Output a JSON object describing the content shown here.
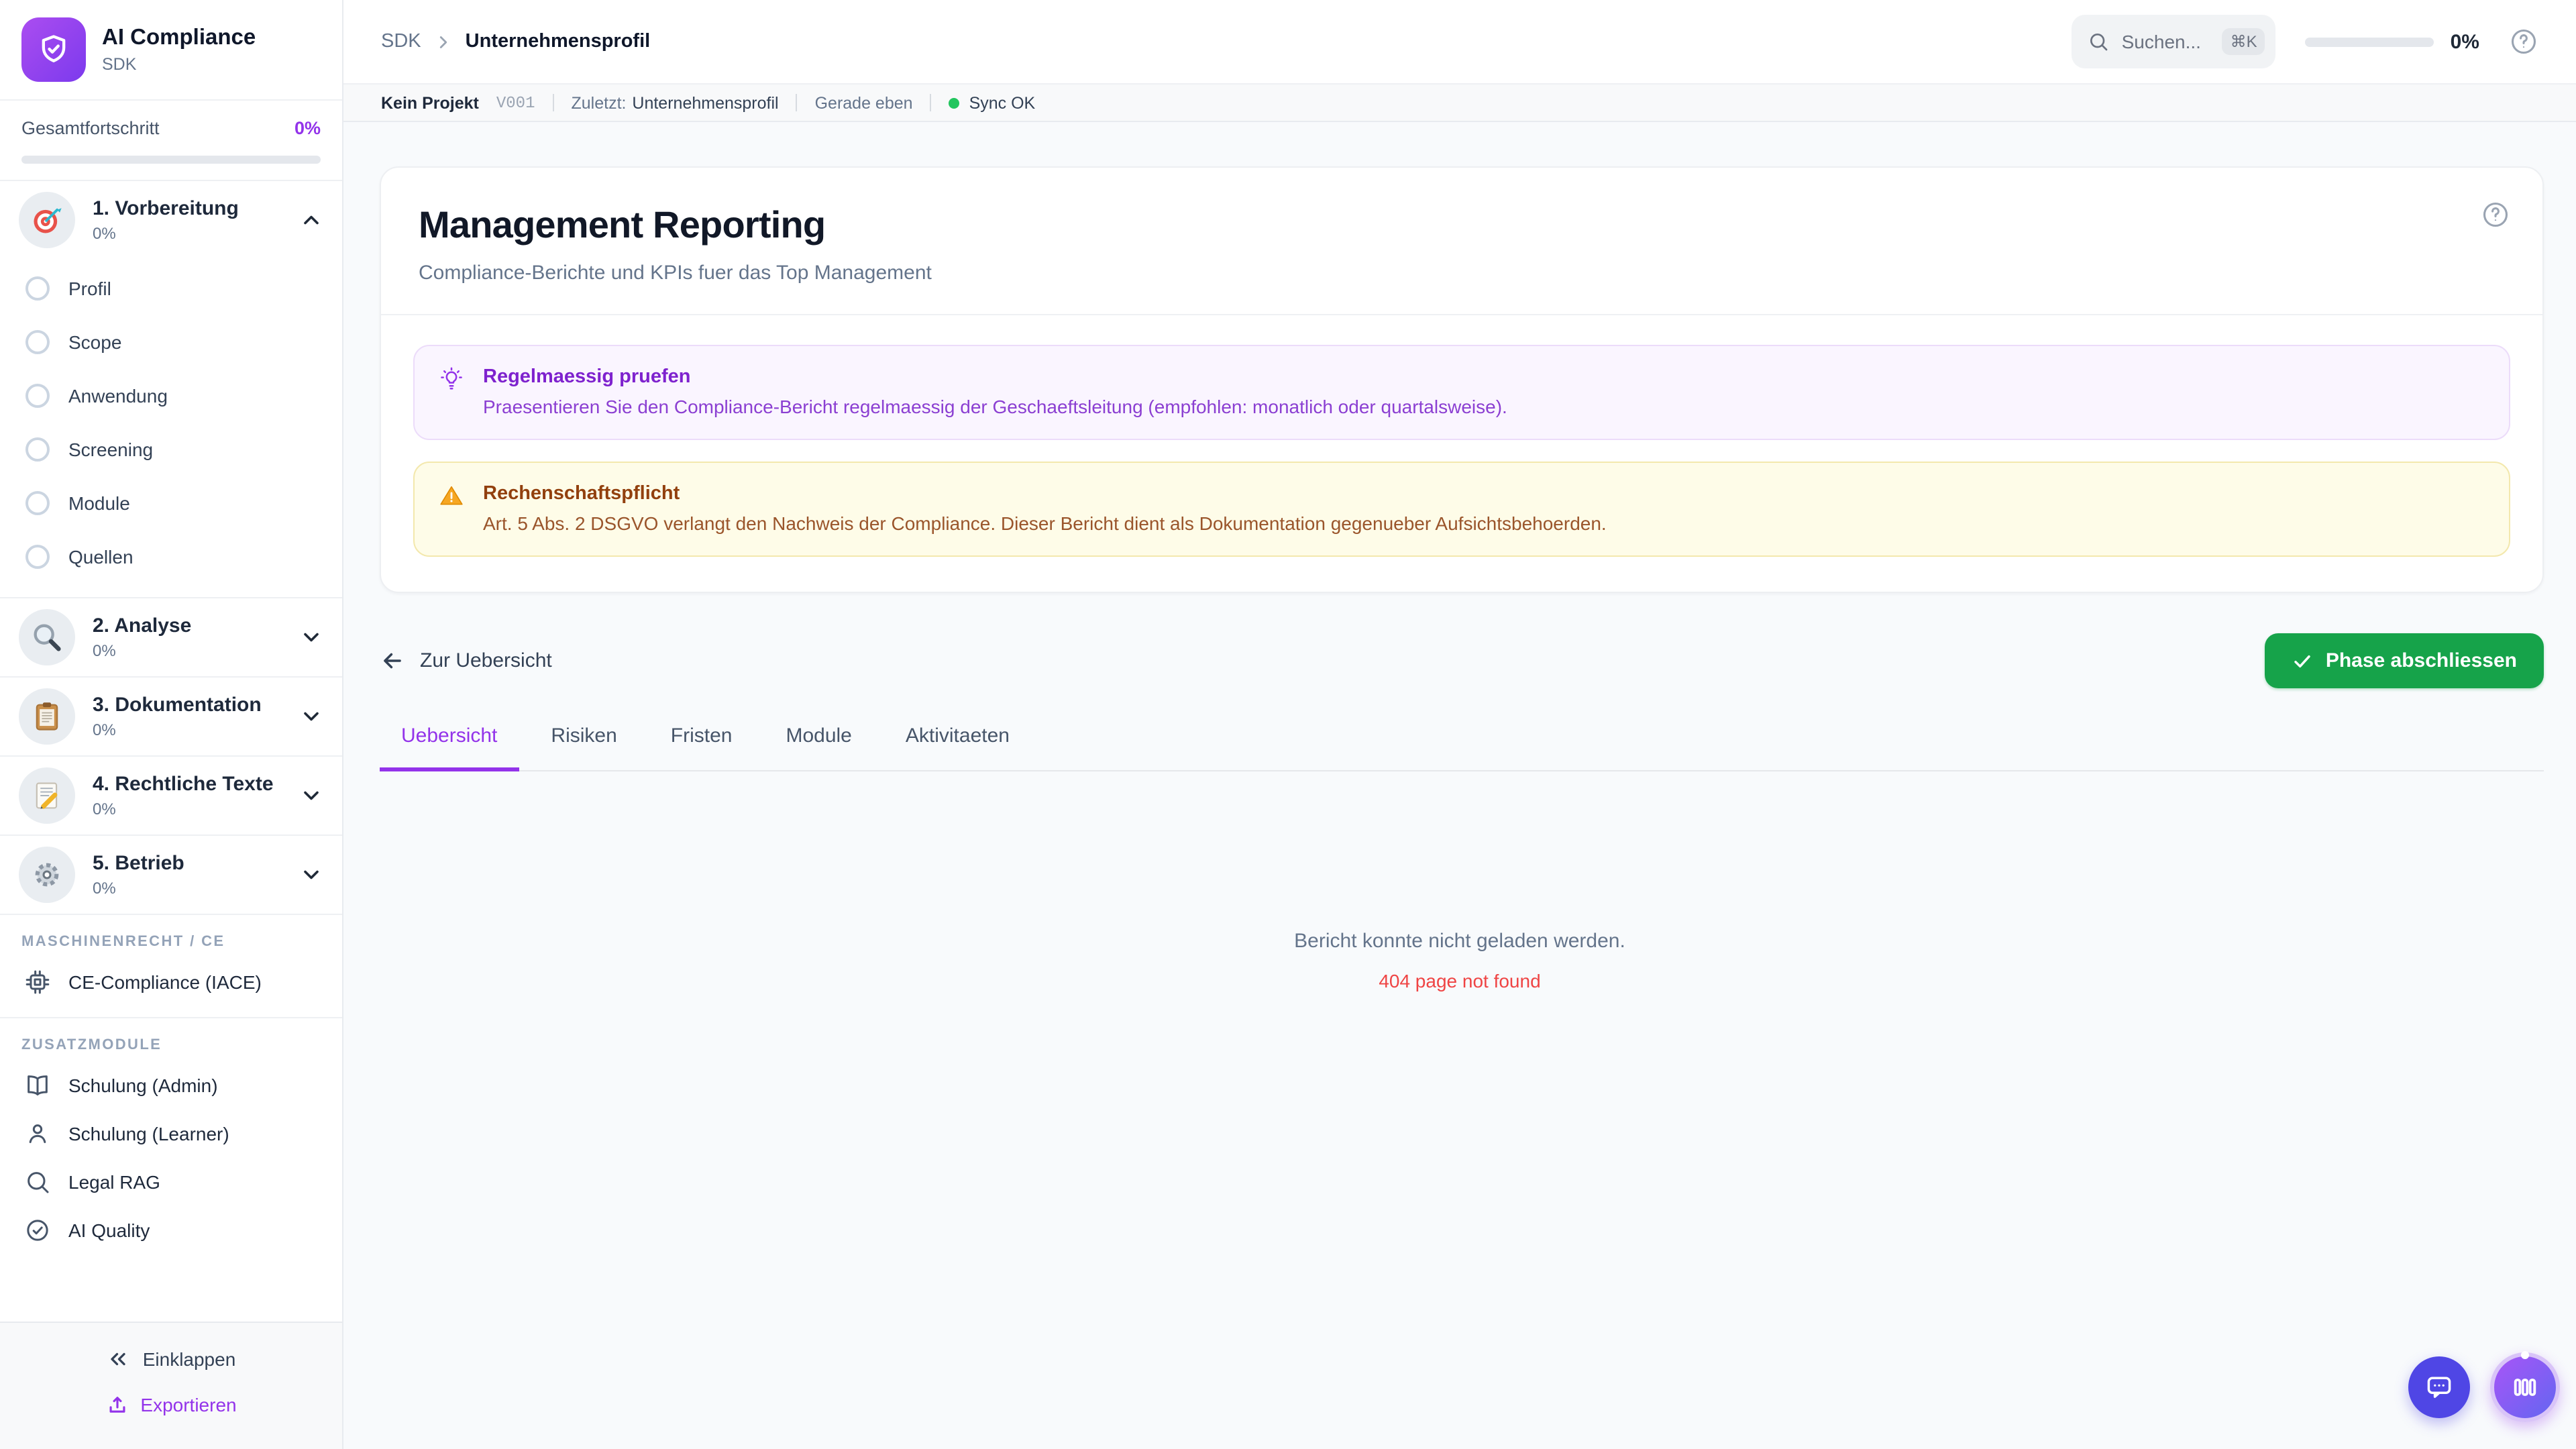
{
  "colors": {
    "accent_purple": "#9333ea",
    "logo_gradient_start": "#a855f7",
    "logo_gradient_end": "#7c3aed",
    "success_green": "#16a34a",
    "sync_green": "#22c55e",
    "error_red": "#ef4444",
    "fab_indigo": "#4f46e5",
    "info_callout_bg": "#faf5ff",
    "warning_callout_bg": "#fefce8",
    "warning_text": "#92400e"
  },
  "sidebar": {
    "app_title": "AI Compliance",
    "app_subtitle": "SDK",
    "progress_label": "Gesamtfortschritt",
    "progress_value": "0%",
    "phases": [
      {
        "label": "1. Vorbereitung",
        "percent": "0%",
        "icon": "target-icon",
        "expanded": true,
        "items": [
          "Profil",
          "Scope",
          "Anwendung",
          "Screening",
          "Module",
          "Quellen"
        ]
      },
      {
        "label": "2. Analyse",
        "percent": "0%",
        "icon": "magnifier-icon",
        "expanded": false
      },
      {
        "label": "3. Dokumentation",
        "percent": "0%",
        "icon": "clipboard-icon",
        "expanded": false
      },
      {
        "label": "4. Rechtliche Texte",
        "percent": "0%",
        "icon": "memo-pencil-icon",
        "expanded": false
      },
      {
        "label": "5. Betrieb",
        "percent": "0%",
        "icon": "gear-icon",
        "expanded": false
      }
    ],
    "section_machine": {
      "heading": "MASCHINENRECHT / CE",
      "items": [
        {
          "label": "CE-Compliance (IACE)",
          "icon": "chip-icon"
        }
      ]
    },
    "section_addons": {
      "heading": "ZUSATZMODULE",
      "items": [
        {
          "label": "Schulung (Admin)",
          "icon": "book-icon"
        },
        {
          "label": "Schulung (Learner)",
          "icon": "user-icon"
        },
        {
          "label": "Legal RAG",
          "icon": "search-icon"
        },
        {
          "label": "AI Quality",
          "icon": "check-circle-icon"
        }
      ]
    },
    "collapse_label": "Einklappen",
    "export_label": "Exportieren"
  },
  "topbar": {
    "breadcrumb": [
      "SDK",
      "Unternehmensprofil"
    ],
    "search_placeholder": "Suchen...",
    "search_shortcut": "⌘K",
    "progress_value": "0%"
  },
  "statusbar": {
    "project": "Kein Projekt",
    "version": "V001",
    "last_label": "Zuletzt:",
    "last_value": "Unternehmensprofil",
    "time": "Gerade eben",
    "sync": "Sync OK"
  },
  "main": {
    "title": "Management Reporting",
    "subtitle": "Compliance-Berichte und KPIs fuer das Top Management",
    "callout_info": {
      "title": "Regelmaessig pruefen",
      "body": "Praesentieren Sie den Compliance-Bericht regelmaessig der Geschaeftsleitung (empfohlen: monatlich oder quartalsweise)."
    },
    "callout_warning": {
      "title": "Rechenschaftspflicht",
      "body": "Art. 5 Abs. 2 DSGVO verlangt den Nachweis der Compliance. Dieser Bericht dient als Dokumentation gegenueber Aufsichtsbehoerden."
    },
    "back_label": "Zur Uebersicht",
    "complete_button": "Phase abschliessen",
    "tabs": [
      "Uebersicht",
      "Risiken",
      "Fristen",
      "Module",
      "Aktivitaeten"
    ],
    "active_tab": "Uebersicht",
    "error_primary": "Bericht konnte nicht geladen werden.",
    "error_secondary": "404 page not found"
  }
}
